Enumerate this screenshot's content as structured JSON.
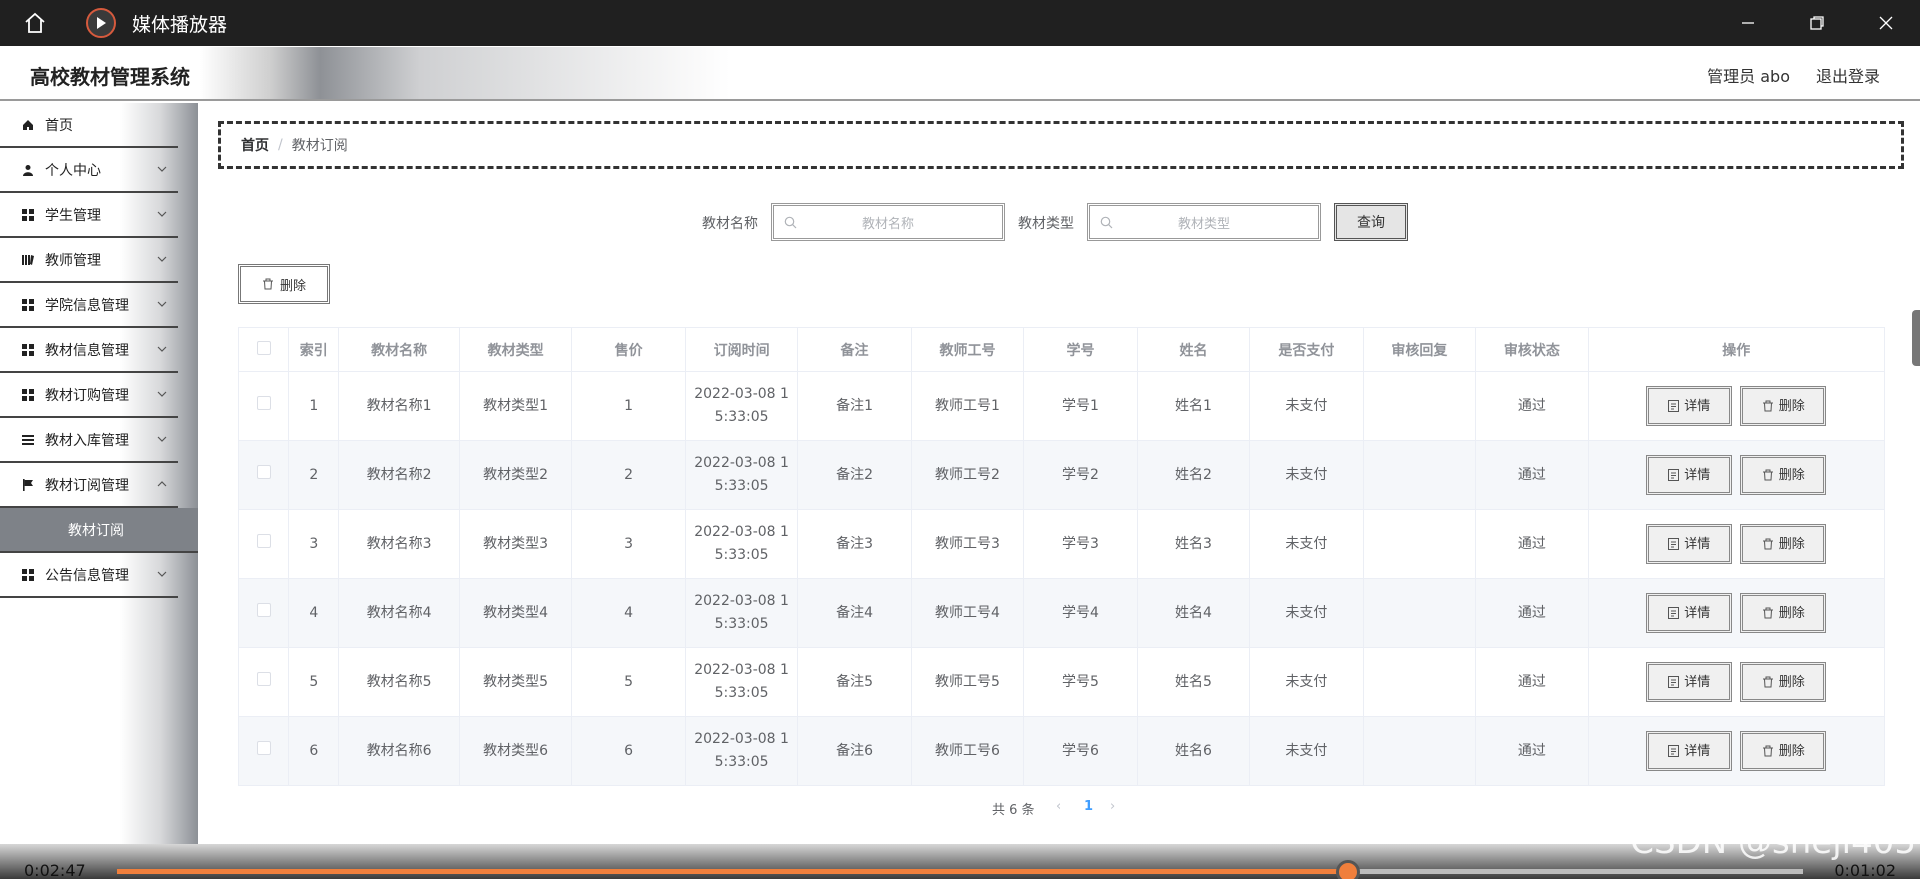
{
  "player": {
    "title": "媒体播放器",
    "time_elapsed": "0:02:47",
    "time_remaining": "0:01:02",
    "progress": 0.73
  },
  "header": {
    "system_title": "高校教材管理系统",
    "admin_label": "管理员 abo",
    "logout_label": "退出登录"
  },
  "sidebar": {
    "items": [
      {
        "label": "首页",
        "icon": "home-icon",
        "has_children": false
      },
      {
        "label": "个人中心",
        "icon": "user-icon",
        "has_children": true
      },
      {
        "label": "学生管理",
        "icon": "grid-icon",
        "has_children": true
      },
      {
        "label": "教师管理",
        "icon": "book-icon",
        "has_children": true
      },
      {
        "label": "学院信息管理",
        "icon": "grid-icon",
        "has_children": true
      },
      {
        "label": "教材信息管理",
        "icon": "grid-icon",
        "has_children": true
      },
      {
        "label": "教材订购管理",
        "icon": "grid-icon",
        "has_children": true
      },
      {
        "label": "教材入库管理",
        "icon": "list-icon",
        "has_children": true
      },
      {
        "label": "教材订阅管理",
        "icon": "flag-icon",
        "has_children": true
      },
      {
        "label": "公告信息管理",
        "icon": "grid-icon",
        "has_children": true
      }
    ],
    "active_submenu": "教材订阅"
  },
  "breadcrumb": {
    "home": "首页",
    "separator": "/",
    "current": "教材订阅"
  },
  "search": {
    "name_label": "教材名称",
    "name_placeholder": "教材名称",
    "type_label": "教材类型",
    "type_placeholder": "教材类型",
    "query_label": "查询"
  },
  "toolbar": {
    "delete_label": "删除"
  },
  "table": {
    "columns": [
      "索引",
      "教材名称",
      "教材类型",
      "售价",
      "订阅时间",
      "备注",
      "教师工号",
      "学号",
      "姓名",
      "是否支付",
      "审核回复",
      "审核状态",
      "操作"
    ],
    "rows": [
      {
        "index": "1",
        "name": "教材名称1",
        "type": "教材类型1",
        "price": "1",
        "time1": "2022-03-08 1",
        "time2": "5:33:05",
        "note": "备注1",
        "teacher_id": "教师工号1",
        "student_id": "学号1",
        "student_name": "姓名1",
        "paid": "未支付",
        "reply": "",
        "status": "通过"
      },
      {
        "index": "2",
        "name": "教材名称2",
        "type": "教材类型2",
        "price": "2",
        "time1": "2022-03-08 1",
        "time2": "5:33:05",
        "note": "备注2",
        "teacher_id": "教师工号2",
        "student_id": "学号2",
        "student_name": "姓名2",
        "paid": "未支付",
        "reply": "",
        "status": "通过"
      },
      {
        "index": "3",
        "name": "教材名称3",
        "type": "教材类型3",
        "price": "3",
        "time1": "2022-03-08 1",
        "time2": "5:33:05",
        "note": "备注3",
        "teacher_id": "教师工号3",
        "student_id": "学号3",
        "student_name": "姓名3",
        "paid": "未支付",
        "reply": "",
        "status": "通过"
      },
      {
        "index": "4",
        "name": "教材名称4",
        "type": "教材类型4",
        "price": "4",
        "time1": "2022-03-08 1",
        "time2": "5:33:05",
        "note": "备注4",
        "teacher_id": "教师工号4",
        "student_id": "学号4",
        "student_name": "姓名4",
        "paid": "未支付",
        "reply": "",
        "status": "通过"
      },
      {
        "index": "5",
        "name": "教材名称5",
        "type": "教材类型5",
        "price": "5",
        "time1": "2022-03-08 1",
        "time2": "5:33:05",
        "note": "备注5",
        "teacher_id": "教师工号5",
        "student_id": "学号5",
        "student_name": "姓名5",
        "paid": "未支付",
        "reply": "",
        "status": "通过"
      },
      {
        "index": "6",
        "name": "教材名称6",
        "type": "教材类型6",
        "price": "6",
        "time1": "2022-03-08 1",
        "time2": "5:33:05",
        "note": "备注6",
        "teacher_id": "教师工号6",
        "student_id": "学号6",
        "student_name": "姓名6",
        "paid": "未支付",
        "reply": "",
        "status": "通过"
      }
    ],
    "detail_label": "详情",
    "delete_label": "删除"
  },
  "pagination": {
    "total": "共 6 条",
    "prev": "‹",
    "current": "1",
    "next": "›"
  },
  "watermark": "CSDN @sheji405",
  "colors": {
    "accent": "#409eff",
    "seek": "#f07f3c",
    "title_bar": "#202020"
  }
}
